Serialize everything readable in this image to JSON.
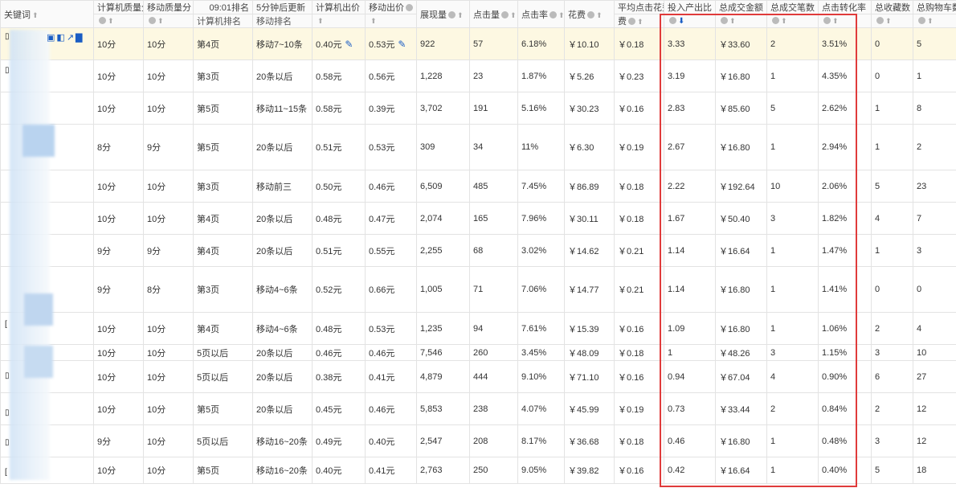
{
  "headers": {
    "keyword": "关键词",
    "pc_quality": "计算机质量分",
    "mobile_quality": "移动质量分",
    "time_label": "09:01排名",
    "update_label": "5分钟后更新",
    "pc_rank": "计算机排名",
    "mobile_rank": "移动排名",
    "pc_bid": "计算机出价",
    "mobile_bid": "移动出价",
    "impressions": "展现量",
    "clicks": "点击量",
    "ctr": "点击率",
    "cost": "花费",
    "avg_cpc": "平均点击花费",
    "roi": "投入产出比",
    "total_gmv": "总成交金额",
    "total_orders": "总成交笔数",
    "cvr": "点击转化率",
    "favorites": "总收藏数",
    "cart": "总购物车数"
  },
  "icons": {
    "sort": "sort-arrow-icon",
    "help": "question-icon",
    "edit": "pencil-icon",
    "sort_active": "sort-down-active-icon"
  },
  "colors": {
    "accent": "#1a5dc4",
    "highlight_row": "#fdf8e2",
    "red_box": "#e03b3b"
  },
  "rows": [
    {
      "pcq": "10分",
      "mq": "10分",
      "pcr": "第4页",
      "mr": "移动7~10条",
      "pcb": "0.40元",
      "mb": "0.53元",
      "imp": "922",
      "clk": "57",
      "ctr": "6.18%",
      "cost": "￥10.10",
      "cpc": "￥0.18",
      "roi": "3.33",
      "gmv": "￥33.60",
      "ord": "2",
      "cvr": "3.51%",
      "fav": "0",
      "cart": "5"
    },
    {
      "pcq": "10分",
      "mq": "10分",
      "pcr": "第3页",
      "mr": "20条以后",
      "pcb": "0.58元",
      "mb": "0.56元",
      "imp": "1,228",
      "clk": "23",
      "ctr": "1.87%",
      "cost": "￥5.26",
      "cpc": "￥0.23",
      "roi": "3.19",
      "gmv": "￥16.80",
      "ord": "1",
      "cvr": "4.35%",
      "fav": "0",
      "cart": "1"
    },
    {
      "pcq": "10分",
      "mq": "10分",
      "pcr": "第5页",
      "mr": "移动11~15条",
      "pcb": "0.58元",
      "mb": "0.39元",
      "imp": "3,702",
      "clk": "191",
      "ctr": "5.16%",
      "cost": "￥30.23",
      "cpc": "￥0.16",
      "roi": "2.83",
      "gmv": "￥85.60",
      "ord": "5",
      "cvr": "2.62%",
      "fav": "1",
      "cart": "8"
    },
    {
      "pcq": "8分",
      "mq": "9分",
      "pcr": "第5页",
      "mr": "20条以后",
      "pcb": "0.51元",
      "mb": "0.53元",
      "imp": "309",
      "clk": "34",
      "ctr": "11%",
      "cost": "￥6.30",
      "cpc": "￥0.19",
      "roi": "2.67",
      "gmv": "￥16.80",
      "ord": "1",
      "cvr": "2.94%",
      "fav": "1",
      "cart": "2"
    },
    {
      "pcq": "10分",
      "mq": "10分",
      "pcr": "第3页",
      "mr": "移动前三",
      "pcb": "0.50元",
      "mb": "0.46元",
      "imp": "6,509",
      "clk": "485",
      "ctr": "7.45%",
      "cost": "￥86.89",
      "cpc": "￥0.18",
      "roi": "2.22",
      "gmv": "￥192.64",
      "ord": "10",
      "cvr": "2.06%",
      "fav": "5",
      "cart": "23"
    },
    {
      "pcq": "10分",
      "mq": "10分",
      "pcr": "第4页",
      "mr": "20条以后",
      "pcb": "0.48元",
      "mb": "0.47元",
      "imp": "2,074",
      "clk": "165",
      "ctr": "7.96%",
      "cost": "￥30.11",
      "cpc": "￥0.18",
      "roi": "1.67",
      "gmv": "￥50.40",
      "ord": "3",
      "cvr": "1.82%",
      "fav": "4",
      "cart": "7"
    },
    {
      "pcq": "9分",
      "mq": "9分",
      "pcr": "第4页",
      "mr": "20条以后",
      "pcb": "0.51元",
      "mb": "0.55元",
      "imp": "2,255",
      "clk": "68",
      "ctr": "3.02%",
      "cost": "￥14.62",
      "cpc": "￥0.21",
      "roi": "1.14",
      "gmv": "￥16.64",
      "ord": "1",
      "cvr": "1.47%",
      "fav": "1",
      "cart": "3"
    },
    {
      "pcq": "9分",
      "mq": "8分",
      "pcr": "第3页",
      "mr": "移动4~6条",
      "pcb": "0.52元",
      "mb": "0.66元",
      "imp": "1,005",
      "clk": "71",
      "ctr": "7.06%",
      "cost": "￥14.77",
      "cpc": "￥0.21",
      "roi": "1.14",
      "gmv": "￥16.80",
      "ord": "1",
      "cvr": "1.41%",
      "fav": "0",
      "cart": "0"
    },
    {
      "pcq": "10分",
      "mq": "10分",
      "pcr": "第4页",
      "mr": "移动4~6条",
      "pcb": "0.48元",
      "mb": "0.53元",
      "imp": "1,235",
      "clk": "94",
      "ctr": "7.61%",
      "cost": "￥15.39",
      "cpc": "￥0.16",
      "roi": "1.09",
      "gmv": "￥16.80",
      "ord": "1",
      "cvr": "1.06%",
      "fav": "2",
      "cart": "4"
    },
    {
      "pcq": "10分",
      "mq": "10分",
      "pcr": "5页以后",
      "mr": "20条以后",
      "pcb": "0.46元",
      "mb": "0.46元",
      "imp": "7,546",
      "clk": "260",
      "ctr": "3.45%",
      "cost": "￥48.09",
      "cpc": "￥0.18",
      "roi": "1",
      "gmv": "￥48.26",
      "ord": "3",
      "cvr": "1.15%",
      "fav": "3",
      "cart": "10"
    },
    {
      "pcq": "10分",
      "mq": "10分",
      "pcr": "5页以后",
      "mr": "20条以后",
      "pcb": "0.38元",
      "mb": "0.41元",
      "imp": "4,879",
      "clk": "444",
      "ctr": "9.10%",
      "cost": "￥71.10",
      "cpc": "￥0.16",
      "roi": "0.94",
      "gmv": "￥67.04",
      "ord": "4",
      "cvr": "0.90%",
      "fav": "6",
      "cart": "27"
    },
    {
      "pcq": "10分",
      "mq": "10分",
      "pcr": "第5页",
      "mr": "20条以后",
      "pcb": "0.45元",
      "mb": "0.46元",
      "imp": "5,853",
      "clk": "238",
      "ctr": "4.07%",
      "cost": "￥45.99",
      "cpc": "￥0.19",
      "roi": "0.73",
      "gmv": "￥33.44",
      "ord": "2",
      "cvr": "0.84%",
      "fav": "2",
      "cart": "12"
    },
    {
      "pcq": "9分",
      "mq": "10分",
      "pcr": "5页以后",
      "mr": "移动16~20条",
      "pcb": "0.49元",
      "mb": "0.40元",
      "imp": "2,547",
      "clk": "208",
      "ctr": "8.17%",
      "cost": "￥36.68",
      "cpc": "￥0.18",
      "roi": "0.46",
      "gmv": "￥16.80",
      "ord": "1",
      "cvr": "0.48%",
      "fav": "3",
      "cart": "12"
    },
    {
      "pcq": "10分",
      "mq": "10分",
      "pcr": "第5页",
      "mr": "移动16~20条",
      "pcb": "0.40元",
      "mb": "0.41元",
      "imp": "2,763",
      "clk": "250",
      "ctr": "9.05%",
      "cost": "￥39.82",
      "cpc": "￥0.16",
      "roi": "0.42",
      "gmv": "￥16.64",
      "ord": "1",
      "cvr": "0.40%",
      "fav": "5",
      "cart": "18"
    }
  ]
}
